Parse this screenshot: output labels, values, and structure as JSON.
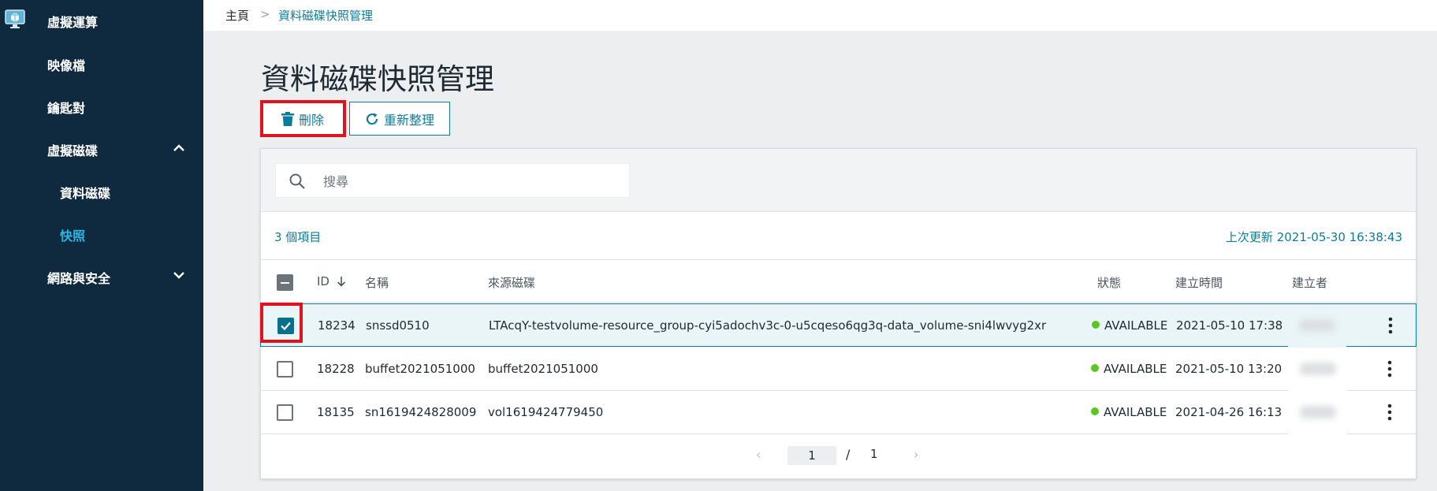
{
  "sidebar": {
    "items": [
      {
        "label": "虛擬運算"
      },
      {
        "label": "映像檔"
      },
      {
        "label": "鑰匙對"
      },
      {
        "label": "虛擬磁碟"
      },
      {
        "label": "資料磁碟"
      },
      {
        "label": "快照"
      },
      {
        "label": "網路與安全"
      }
    ]
  },
  "breadcrumb": {
    "home": "主頁",
    "separator": ">",
    "current": "資料磁碟快照管理"
  },
  "page": {
    "title": "資料磁碟快照管理"
  },
  "toolbar": {
    "delete_label": "刪除",
    "refresh_label": "重新整理"
  },
  "search": {
    "placeholder": "搜尋"
  },
  "info": {
    "count": "3 個項目",
    "last_update": "上次更新 2021-05-30 16:38:43"
  },
  "table": {
    "headers": {
      "id": "ID",
      "name": "名稱",
      "source": "來源磁碟",
      "status": "狀態",
      "created": "建立時間",
      "creator": "建立者"
    },
    "rows": [
      {
        "id": "18234",
        "name": "snssd0510",
        "source": "LTAcqY-testvolume-resource_group-cyi5adochv3c-0-u5cqeso6qg3q-data_volume-sni4lwvyg2xr",
        "status": "AVAILABLE",
        "created": "2021-05-10 17:38",
        "checked": true
      },
      {
        "id": "18228",
        "name": "buffet2021051000",
        "source": "buffet2021051000",
        "status": "AVAILABLE",
        "created": "2021-05-10 13:20",
        "checked": false
      },
      {
        "id": "18135",
        "name": "sn1619424828009",
        "source": "vol1619424779450",
        "status": "AVAILABLE",
        "created": "2021-04-26 16:13",
        "checked": false
      }
    ]
  },
  "pagination": {
    "current": "1",
    "separator": "/",
    "total": "1"
  },
  "colors": {
    "sidebar_bg": "#0f2a3f",
    "accent": "#0b7d9a",
    "active_nav": "#29b6e8",
    "highlight": "#e0141e",
    "status_ok": "#57c91d"
  }
}
